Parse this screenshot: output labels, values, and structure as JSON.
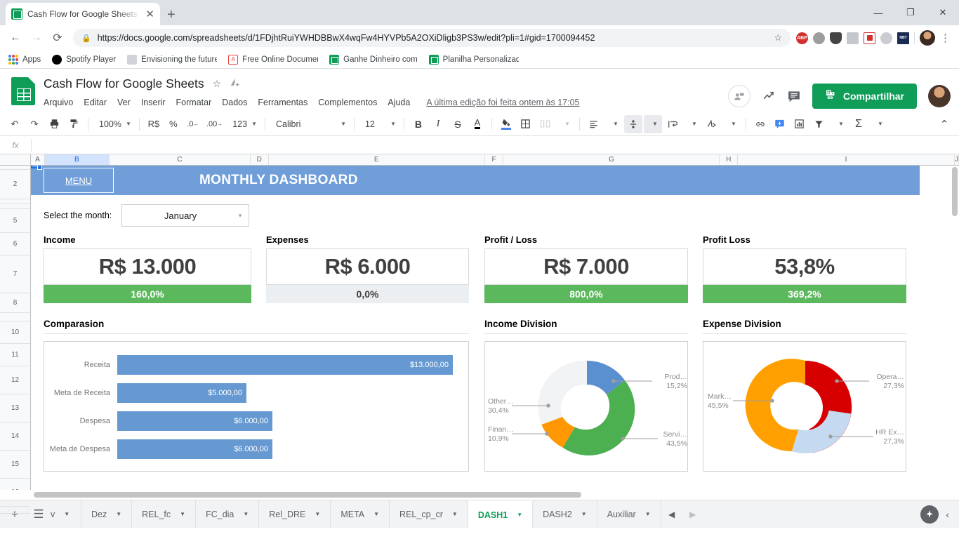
{
  "browser": {
    "tab": {
      "title": "Cash Flow for Google Sheets - Pla",
      "close": "✕",
      "favicon": "sheets-icon"
    },
    "new_tab": "+",
    "window_controls": {
      "minimize": "—",
      "maximize": "❐",
      "close": "✕"
    },
    "nav": {
      "back": "←",
      "forward": "→",
      "reload": "⟳"
    },
    "url": {
      "lock": "🔒",
      "scheme": "https://",
      "domain": "docs.google.com",
      "path": "/spreadsheets/d/1FDjhtRuiYWHDBBwX4wqFw4HYVPb5A2OXiDligb3PS3w/edit?pli=1#gid=1700094452",
      "full": "https://docs.google.com/spreadsheets/d/1FDjhtRuiYWHDBBwX4wqFw4HYVPb5A2OXiDligb3PS3w/edit?pli=1#gid=1700094452",
      "star": "☆"
    },
    "extensions": [
      {
        "name": "adblock-plus-icon",
        "label": "ABP"
      },
      {
        "name": "gear-extension-icon",
        "label": ""
      },
      {
        "name": "shield-extension-icon",
        "label": ""
      },
      {
        "name": "chat-extension-icon",
        "label": ""
      },
      {
        "name": "avast-extension-icon",
        "label": ""
      },
      {
        "name": "skype-extension-icon",
        "label": "S"
      },
      {
        "name": "nbt-extension-icon",
        "label": "NBT"
      }
    ],
    "menu": "⋮",
    "bookmarks": [
      {
        "label": "Apps",
        "icon": "apps-grid-icon"
      },
      {
        "label": "Spotify Player",
        "icon": "spotify-icon"
      },
      {
        "label": "Envisioning the future",
        "icon": "generic-page-icon"
      },
      {
        "label": "Free Online Documen",
        "icon": "pdf-icon"
      },
      {
        "label": "Ganhe Dinheiro com",
        "icon": "sheets-icon"
      },
      {
        "label": "Planilha Personalizad",
        "icon": "sheets-icon"
      }
    ]
  },
  "app": {
    "logo": "google-sheets-logo",
    "doc_title": "Cash Flow for Google Sheets",
    "star": "☆",
    "drive_move": "move-to-drive-icon",
    "menus": [
      "Arquivo",
      "Editar",
      "Ver",
      "Inserir",
      "Formatar",
      "Dados",
      "Ferramentas",
      "Complementos",
      "Ajuda"
    ],
    "last_edit": "A última edição foi feita ontem às 17:05",
    "meet_icon": "present-icon",
    "activity_icon": "activity-dashboard-icon",
    "comments_icon": "comments-icon",
    "share_label": "Compartilhar",
    "share_icon": "lock-share-icon",
    "avatar": "user-avatar"
  },
  "toolbar": {
    "undo": "↶",
    "redo": "↷",
    "print": "🖶",
    "paint": "paint-format-icon",
    "zoom": "100%",
    "currency": "R$",
    "percent": "%",
    "dec_less": ".0",
    "dec_more": ".00",
    "formats": "123",
    "font": "Calibri",
    "font_size": "12",
    "bold": "B",
    "italic": "I",
    "strike": "S",
    "text_color": "A",
    "fill_color": "fill-color-icon",
    "borders": "borders-icon",
    "merge": "merge-cells-icon",
    "halign": "align-left-icon",
    "valign": "align-middle-icon",
    "wrap": "text-wrap-icon",
    "rotate": "text-rotate-icon",
    "link": "link-icon",
    "comment": "insert-comment-icon",
    "chart": "insert-chart-icon",
    "filter": "filter-icon",
    "functions": "functions-icon",
    "collapse": "⌃"
  },
  "formula_bar": {
    "fx": "fx",
    "value": ""
  },
  "grid": {
    "columns": [
      "A",
      "B",
      "C",
      "D",
      "E",
      "F",
      "G",
      "H",
      "I",
      "J"
    ],
    "rows": [
      "2",
      "5",
      "6",
      "7",
      "8",
      "10",
      "11",
      "12",
      "13",
      "14",
      "15",
      "16"
    ]
  },
  "dashboard": {
    "menu_button": "MENU",
    "banner_title": "MONTHLY DASHBOARD",
    "month_label": "Select the month:",
    "month_value": "January",
    "month_caret": "▾",
    "kpis": [
      {
        "title": "Income",
        "value": "R$ 13.000",
        "delta": "160,0%",
        "delta_style": "green"
      },
      {
        "title": "Expenses",
        "value": "R$ 6.000",
        "delta": "0,0%",
        "delta_style": "gray"
      },
      {
        "title": "Profit / Loss",
        "value": "R$ 7.000",
        "delta": "800,0%",
        "delta_style": "green"
      },
      {
        "title": "Profit Loss",
        "value": "53,8%",
        "delta": "369,2%",
        "delta_style": "green"
      }
    ],
    "sections": {
      "comparison": "Comparasion",
      "income_division": "Income Division",
      "expense_division": "Expense Division"
    }
  },
  "chart_data": [
    {
      "type": "bar",
      "orientation": "horizontal",
      "title": "Comparasion",
      "categories": [
        "Receita",
        "Meta de Receita",
        "Despesa",
        "Meta de Despesa"
      ],
      "values": [
        13000,
        5000,
        6000,
        6000
      ],
      "labels": [
        "$13.000,00",
        "$5.000,00",
        "$6.000,00",
        "$6.000,00"
      ],
      "series_color": "#6699d1",
      "xlim": [
        0,
        13000
      ],
      "grid": false,
      "legend": "none"
    },
    {
      "type": "pie",
      "variant": "donut",
      "title": "Income Division",
      "categories": [
        "Prod…",
        "Servi…",
        "Finan…",
        "Other…"
      ],
      "values": [
        15.2,
        43.5,
        10.9,
        30.4
      ],
      "labels": [
        "15,2%",
        "43,5%",
        "10,9%",
        "30,4%"
      ],
      "colors": [
        "#5a8fd0",
        "#4caf50",
        "#ff9800",
        "#f1f3f4"
      ],
      "legend": "labels-outside"
    },
    {
      "type": "pie",
      "variant": "donut",
      "title": "Expense Division",
      "categories": [
        "Opera…",
        "HR Ex…",
        "Mark…"
      ],
      "values": [
        27.3,
        27.3,
        45.5
      ],
      "labels": [
        "27,3%",
        "27,3%",
        "45,5%"
      ],
      "colors": [
        "#d60000",
        "#c5d9f1",
        "#ffa000"
      ],
      "legend": "labels-outside"
    }
  ],
  "sheet_tabs": {
    "add": "+",
    "all_sheets": "☰",
    "tabs": [
      {
        "label": "v",
        "active": false
      },
      {
        "label": "Dez",
        "active": false
      },
      {
        "label": "REL_fc",
        "active": false
      },
      {
        "label": "FC_dia",
        "active": false
      },
      {
        "label": "Rel_DRE",
        "active": false
      },
      {
        "label": "META",
        "active": false
      },
      {
        "label": "REL_cp_cr",
        "active": false
      },
      {
        "label": "DASH1",
        "active": true
      },
      {
        "label": "DASH2",
        "active": false
      },
      {
        "label": "Auxiliar",
        "active": false
      }
    ],
    "prev": "◀",
    "next": "▶",
    "explore": "explore-icon",
    "collapse": "‹"
  }
}
